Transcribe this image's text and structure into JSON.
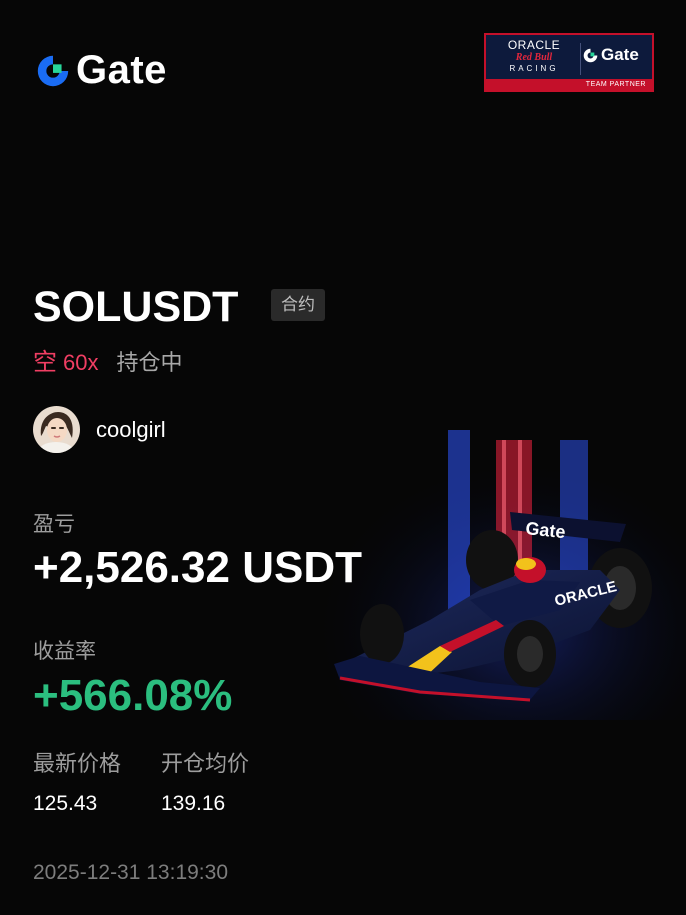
{
  "brand": {
    "name": "Gate",
    "accent_blue": "#1a6cf3",
    "accent_green": "#27d69a"
  },
  "partner_badge": {
    "oracle": "ORACLE",
    "redbull": "Red Bull",
    "racing": "RACING",
    "gate": "Gate",
    "footer": "TEAM PARTNER"
  },
  "position": {
    "symbol": "SOLUSDT",
    "tag": "合约",
    "side": "空",
    "leverage": "60x",
    "status": "持仓中"
  },
  "user": {
    "name": "coolgirl"
  },
  "pnl": {
    "label": "盈亏",
    "value": "+2,526.32 USDT"
  },
  "roi": {
    "label": "收益率",
    "value": "+566.08%"
  },
  "prices": {
    "latest_label": "最新价格",
    "latest_value": "125.43",
    "entry_label": "开仓均价",
    "entry_value": "139.16"
  },
  "timestamp": "2025-12-31 13:19:30",
  "colors": {
    "short_red": "#f03e63",
    "profit_green": "#2bbe7f",
    "muted_text": "#9d9d9d"
  }
}
